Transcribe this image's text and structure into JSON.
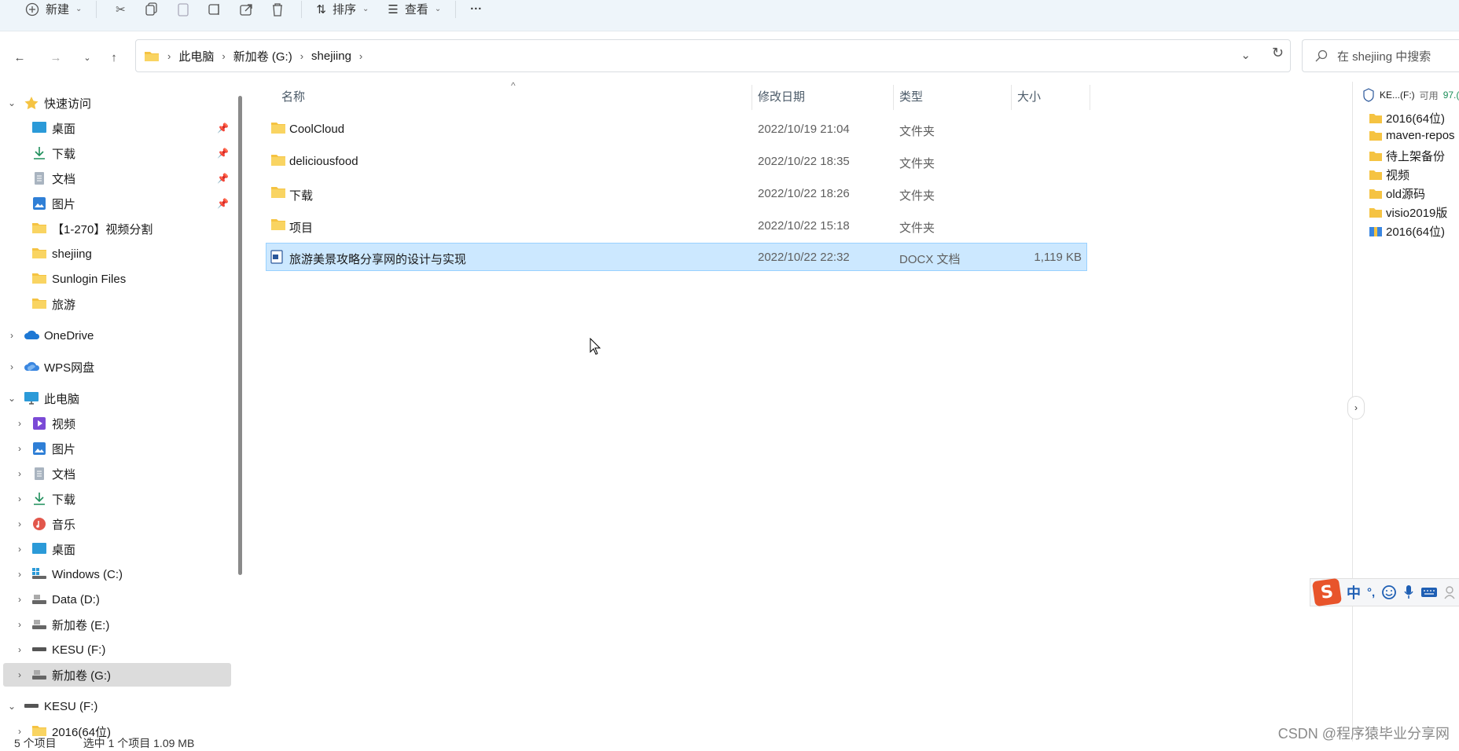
{
  "toolbar": {
    "new_label": "新建",
    "sort_label": "排序",
    "view_label": "查看",
    "more_label": "···"
  },
  "address": {
    "crumbs": [
      "此电脑",
      "新加卷 (G:)",
      "shejiing"
    ],
    "search_placeholder": "在 shejiing 中搜索"
  },
  "sidebar": {
    "quick_access": "快速访问",
    "quick_items": [
      "桌面",
      "下载",
      "文档",
      "图片",
      "【1-270】视频分割",
      "shejiing",
      "Sunlogin Files",
      "旅游"
    ],
    "onedrive": "OneDrive",
    "wps": "WPS网盘",
    "this_pc": "此电脑",
    "pc_items": [
      "视频",
      "图片",
      "文档",
      "下载",
      "音乐",
      "桌面",
      "Windows (C:)",
      "Data (D:)",
      "新加卷 (E:)",
      "KESU  (F:)",
      "新加卷 (G:)"
    ],
    "kesu_drive": "KESU  (F:)",
    "kesu_child": "2016(64位)"
  },
  "filelist": {
    "headers": {
      "name": "名称",
      "date": "修改日期",
      "type": "类型",
      "size": "大小"
    },
    "rows": [
      {
        "name": "CoolCloud",
        "date": "2022/10/19 21:04",
        "type": "文件夹",
        "size": ""
      },
      {
        "name": "deliciousfood",
        "date": "2022/10/22 18:35",
        "type": "文件夹",
        "size": ""
      },
      {
        "name": "下载",
        "date": "2022/10/22 18:26",
        "type": "文件夹",
        "size": ""
      },
      {
        "name": "项目",
        "date": "2022/10/22 15:18",
        "type": "文件夹",
        "size": ""
      },
      {
        "name": "旅游美景攻略分享网的设计与实现",
        "date": "2022/10/22 22:32",
        "type": "DOCX 文档",
        "size": "1,119 KB"
      }
    ]
  },
  "preview": {
    "header": "KE...(F:)",
    "header_free": "可用",
    "header_free_value": "97.(",
    "items": [
      "2016(64位)",
      "maven-repos",
      "待上架备份",
      "视频",
      "old源码",
      "visio2019版",
      "2016(64位)"
    ]
  },
  "ime": {
    "logo": "S",
    "mode": "中",
    "punct": "°,"
  },
  "status": {
    "count": "5 个项目",
    "selection": "选中 1 个项目  1.09 MB"
  },
  "watermark": "CSDN @程序猿毕业分享网",
  "colors": {
    "folder": "#f5c342",
    "selected_row": "#cce8ff",
    "selected_nav": "#dcdcdc",
    "toolbar_bg": "#eef5fa"
  }
}
